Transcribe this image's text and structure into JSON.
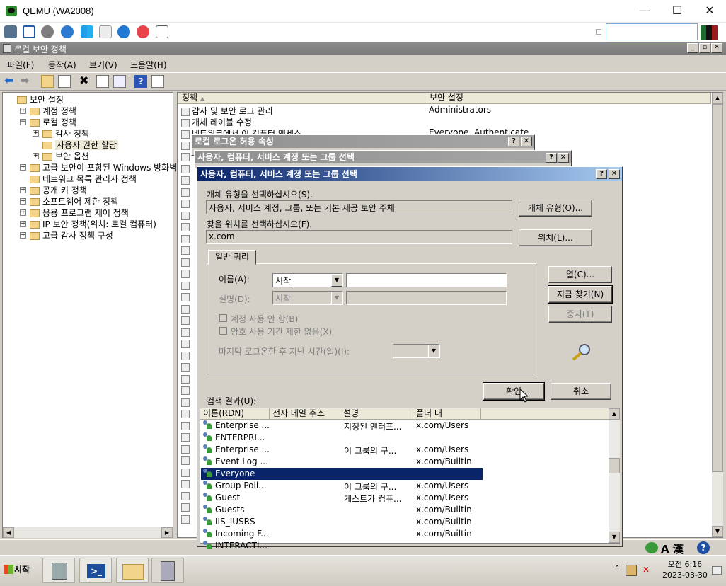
{
  "qemu": {
    "title": "QEMU (WA2008)",
    "win_min": "—",
    "win_max": "☐",
    "win_close": "✕"
  },
  "mmc": {
    "title": "로컬 보안 정책",
    "menu": [
      "파일(F)",
      "동작(A)",
      "보기(V)",
      "도움말(H)"
    ]
  },
  "tree": {
    "items": [
      {
        "label": "보안 설정",
        "indent": 0,
        "expander": "",
        "selected": false
      },
      {
        "label": "계정 정책",
        "indent": 1,
        "expander": "+",
        "selected": false
      },
      {
        "label": "로컬 정책",
        "indent": 1,
        "expander": "−",
        "selected": false
      },
      {
        "label": "감사 정책",
        "indent": 2,
        "expander": "+",
        "selected": false
      },
      {
        "label": "사용자 권한 할당",
        "indent": 2,
        "expander": "",
        "selected": true
      },
      {
        "label": "보안 옵션",
        "indent": 2,
        "expander": "+",
        "selected": false
      },
      {
        "label": "고급 보안이 포함된 Windows 방화벽",
        "indent": 1,
        "expander": "+",
        "selected": false
      },
      {
        "label": "네트워크 목록 관리자 정책",
        "indent": 1,
        "expander": "",
        "selected": false
      },
      {
        "label": "공개 키 정책",
        "indent": 1,
        "expander": "+",
        "selected": false
      },
      {
        "label": "소프트웨어 제한 정책",
        "indent": 1,
        "expander": "+",
        "selected": false
      },
      {
        "label": "응용 프로그램 제어 정책",
        "indent": 1,
        "expander": "+",
        "selected": false
      },
      {
        "label": "IP 보안 정책(위치: 로컬 컴퓨터)",
        "indent": 1,
        "expander": "+",
        "selected": false
      },
      {
        "label": "고급 감사 정책 구성",
        "indent": 1,
        "expander": "+",
        "selected": false
      }
    ]
  },
  "list": {
    "col_policy": "정책",
    "col_setting": "보안 설정",
    "rows": [
      {
        "policy": "감사 및 보안 로그 관리",
        "setting": "Administrators"
      },
      {
        "policy": "개체 레이블 수정",
        "setting": ""
      },
      {
        "policy": "네트워크에서 이 컴퓨터 액세스",
        "setting": "Everyone, Authenticate"
      }
    ]
  },
  "dialog_back1": {
    "title": "로컬 로그온 허용 속성",
    "help": "?",
    "close": "✕"
  },
  "dialog_back2": {
    "title": "사용자, 컴퓨터, 서비스 계정 또는 그룹 선택",
    "help": "?",
    "close": "✕"
  },
  "dialog": {
    "title": "사용자, 컴퓨터, 서비스 계정 또는 그룹 선택",
    "help": "?",
    "close": "✕",
    "object_type_label": "개체 유형을 선택하십시오(S).",
    "object_type_value": "사용자, 서비스 계정, 그룹, 또는 기본 제공 보안 주체",
    "object_type_button": "개체 유형(O)...",
    "location_label": "찾을 위치를 선택하십시오(F).",
    "location_value": "x.com",
    "location_button": "위치(L)...",
    "tab": "일반 쿼리",
    "name_label": "이름(A):",
    "name_combo": "시작",
    "desc_label": "설명(D):",
    "desc_combo": "시작",
    "cb_disabled": "계정 사용 안 함(B)",
    "cb_noexpire": "암호 사용 기간 제한 없음(X)",
    "lastlogon_label": "마지막 로그온한 후 지난 시간(일)(I):",
    "columns_button": "열(C)...",
    "findnow_button": "지금 찾기(N)",
    "stop_button": "중지(T)",
    "ok_button": "확인",
    "cancel_button": "취소",
    "results_label": "검색 결과(U):",
    "results_cols": [
      "이름(RDN)",
      "전자 메일 주소",
      "설명",
      "폴더 내"
    ],
    "results": [
      {
        "name": "Enterprise ...",
        "email": "",
        "desc": "지정된 엔터프...",
        "folder": "x.com/Users",
        "selected": false
      },
      {
        "name": "ENTERPRI...",
        "email": "",
        "desc": "",
        "folder": "",
        "selected": false
      },
      {
        "name": "Enterprise ...",
        "email": "",
        "desc": "이 그룹의 구...",
        "folder": "x.com/Users",
        "selected": false
      },
      {
        "name": "Event Log ...",
        "email": "",
        "desc": "",
        "folder": "x.com/Builtin",
        "selected": false
      },
      {
        "name": "Everyone",
        "email": "",
        "desc": "",
        "folder": "",
        "selected": true
      },
      {
        "name": "Group Poli...",
        "email": "",
        "desc": "이 그룹의 구...",
        "folder": "x.com/Users",
        "selected": false
      },
      {
        "name": "Guest",
        "email": "",
        "desc": "게스트가 컴퓨...",
        "folder": "x.com/Users",
        "selected": false
      },
      {
        "name": "Guests",
        "email": "",
        "desc": "",
        "folder": "x.com/Builtin",
        "selected": false
      },
      {
        "name": "IIS_IUSRS",
        "email": "",
        "desc": "",
        "folder": "x.com/Builtin",
        "selected": false
      },
      {
        "name": "Incoming F...",
        "email": "",
        "desc": "",
        "folder": "x.com/Builtin",
        "selected": false
      },
      {
        "name": "INTERACTI...",
        "email": "",
        "desc": "",
        "folder": "",
        "selected": false
      }
    ]
  },
  "taskbar": {
    "start": "시작",
    "ime": "A 漢",
    "clock_time": "오전 6:16",
    "clock_date": "2023-03-30"
  },
  "colors": {
    "selection": "#0a246a",
    "title_active": "#0a246a",
    "chrome": "#d4d0c8"
  }
}
